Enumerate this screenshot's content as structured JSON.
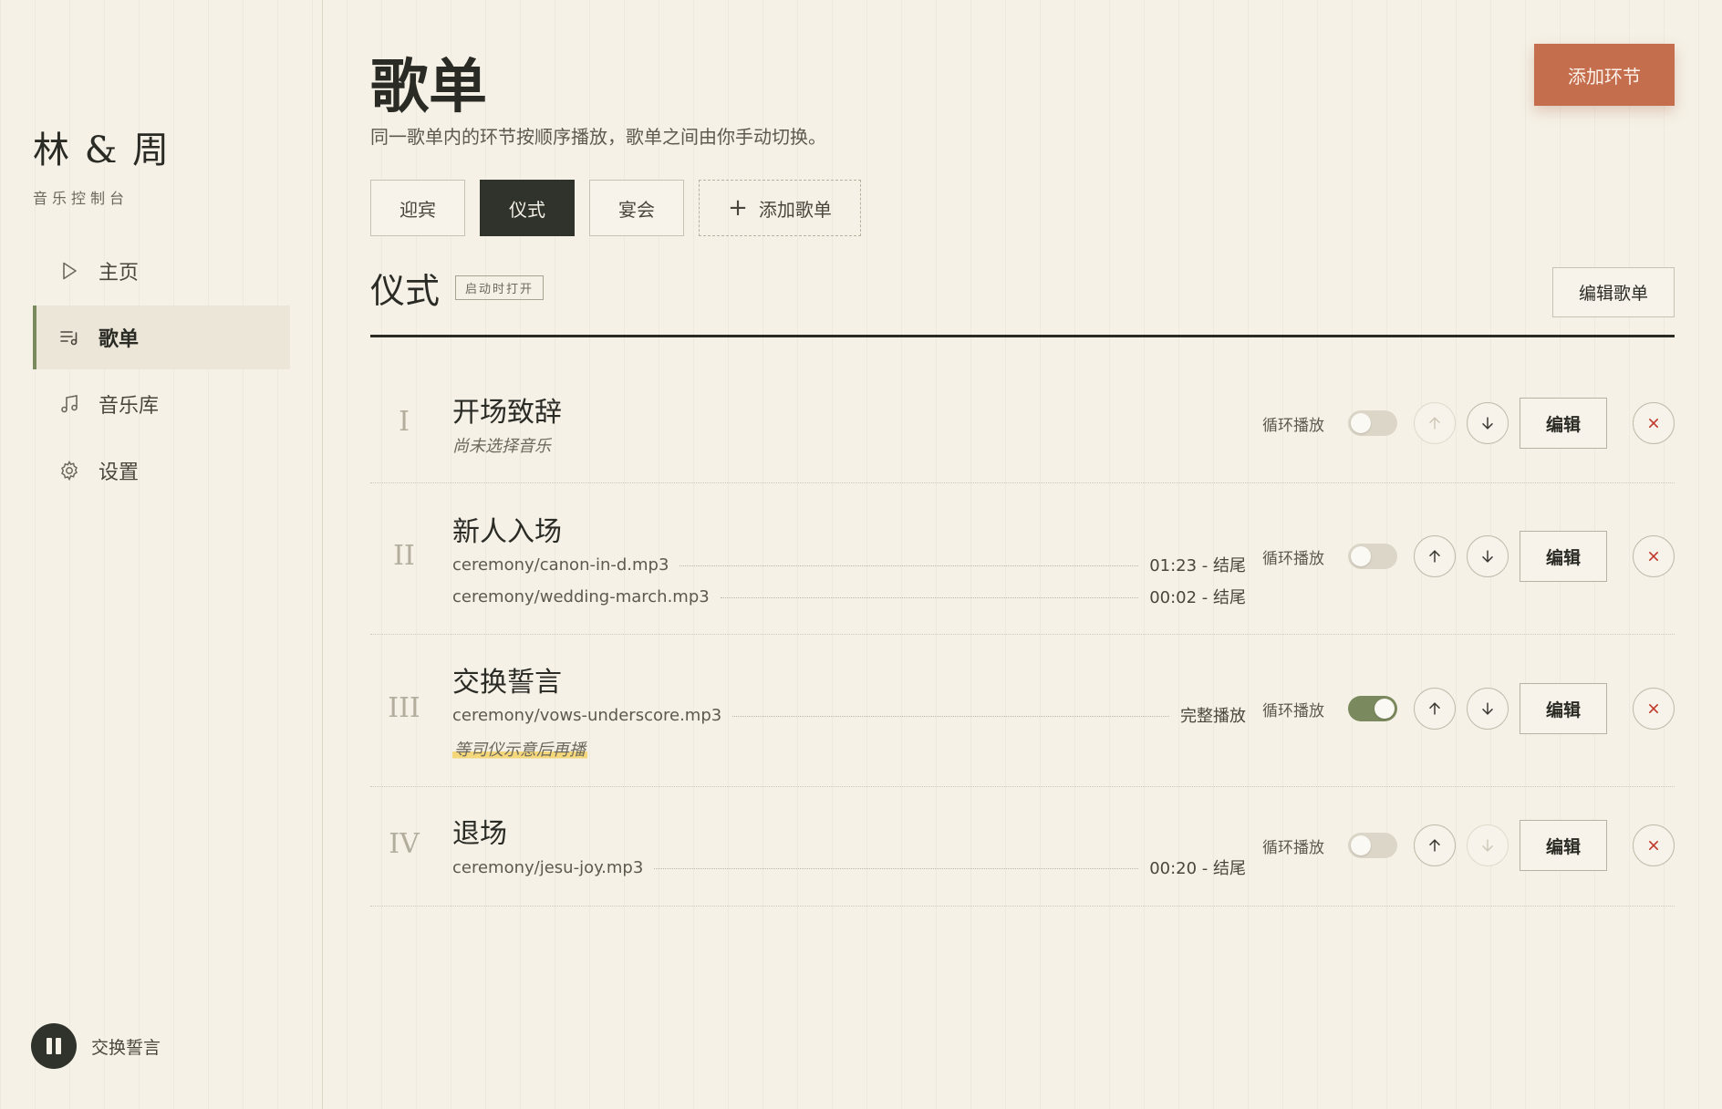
{
  "sidebar": {
    "brand": "林 & 周",
    "subtitle": "音乐控制台",
    "nav": [
      {
        "label": "主页",
        "icon": "play-icon"
      },
      {
        "label": "歌单",
        "icon": "playlist-icon"
      },
      {
        "label": "音乐库",
        "icon": "music-note-icon"
      },
      {
        "label": "设置",
        "icon": "gear-icon"
      }
    ],
    "now_playing": "交换誓言"
  },
  "header": {
    "title": "歌单",
    "description": "同一歌单内的环节按顺序播放，歌单之间由你手动切换。",
    "add_section_label": "添加环节"
  },
  "tabs": [
    {
      "label": "迎宾"
    },
    {
      "label": "仪式"
    },
    {
      "label": "宴会"
    }
  ],
  "add_playlist_label": "添加歌单",
  "playlist": {
    "title": "仪式",
    "badge": "启动时打开",
    "edit_label": "编辑歌单"
  },
  "common": {
    "loop_label": "循环播放",
    "edit_label": "编辑"
  },
  "sections": [
    {
      "numeral": "I",
      "title": "开场致辞",
      "empty_note": "尚未选择音乐",
      "tracks": [],
      "loop": false
    },
    {
      "numeral": "II",
      "title": "新人入场",
      "tracks": [
        {
          "file": "ceremony/canon-in-d.mp3",
          "timing": "01:23 - 结尾"
        },
        {
          "file": "ceremony/wedding-march.mp3",
          "timing": "00:02 - 结尾"
        }
      ],
      "loop": false
    },
    {
      "numeral": "III",
      "title": "交换誓言",
      "tracks": [
        {
          "file": "ceremony/vows-underscore.mp3",
          "timing": "完整播放"
        }
      ],
      "note": "等司仪示意后再播",
      "loop": true
    },
    {
      "numeral": "IV",
      "title": "退场",
      "tracks": [
        {
          "file": "ceremony/jesu-joy.mp3",
          "timing": "00:20 - 结尾"
        }
      ],
      "loop": false
    }
  ],
  "colors": {
    "accent": "#c46e4e",
    "active_tab": "#2f332b",
    "toggle_on": "#7b8a5e",
    "delete": "#c0392b",
    "highlight": "#f3d77a"
  }
}
